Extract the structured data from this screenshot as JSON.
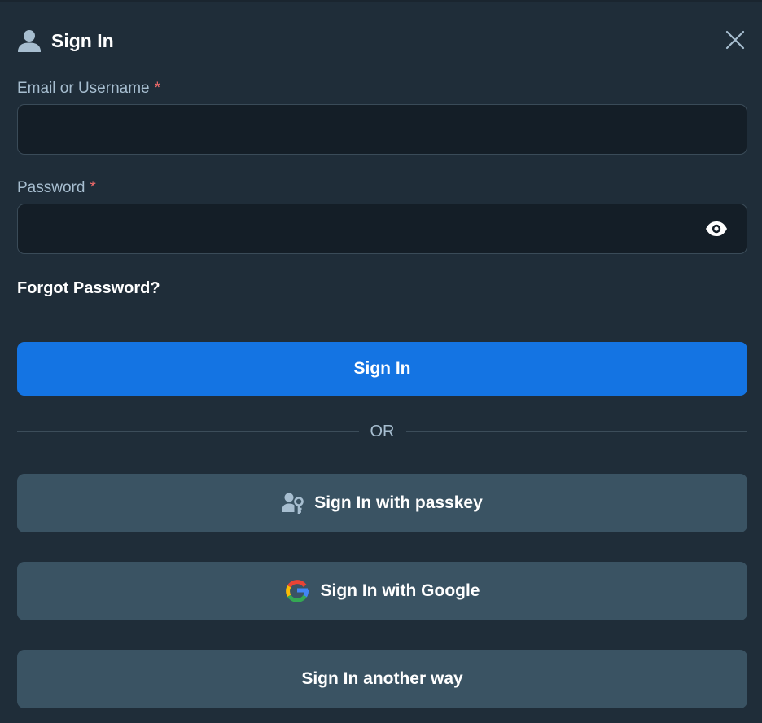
{
  "dialog": {
    "title": "Sign In",
    "title_icon": "user-icon",
    "close_icon": "close-icon"
  },
  "form": {
    "email": {
      "label": "Email or Username",
      "required_marker": "*",
      "value": "",
      "placeholder": ""
    },
    "password": {
      "label": "Password",
      "required_marker": "*",
      "value": "",
      "placeholder": "",
      "toggle_icon": "eye-icon"
    },
    "forgot_password": "Forgot Password?"
  },
  "actions": {
    "sign_in": "Sign In",
    "divider_text": "OR",
    "passkey": {
      "label": "Sign In with passkey",
      "icon": "passkey-icon"
    },
    "google": {
      "label": "Sign In with Google",
      "icon": "google-icon"
    },
    "other": {
      "label": "Sign In another way"
    }
  },
  "colors": {
    "background": "#1f2d39",
    "input_background": "#141e27",
    "primary": "#1474e3",
    "secondary": "#3a5363",
    "label": "#a7bed0",
    "required": "#f26b6b"
  }
}
